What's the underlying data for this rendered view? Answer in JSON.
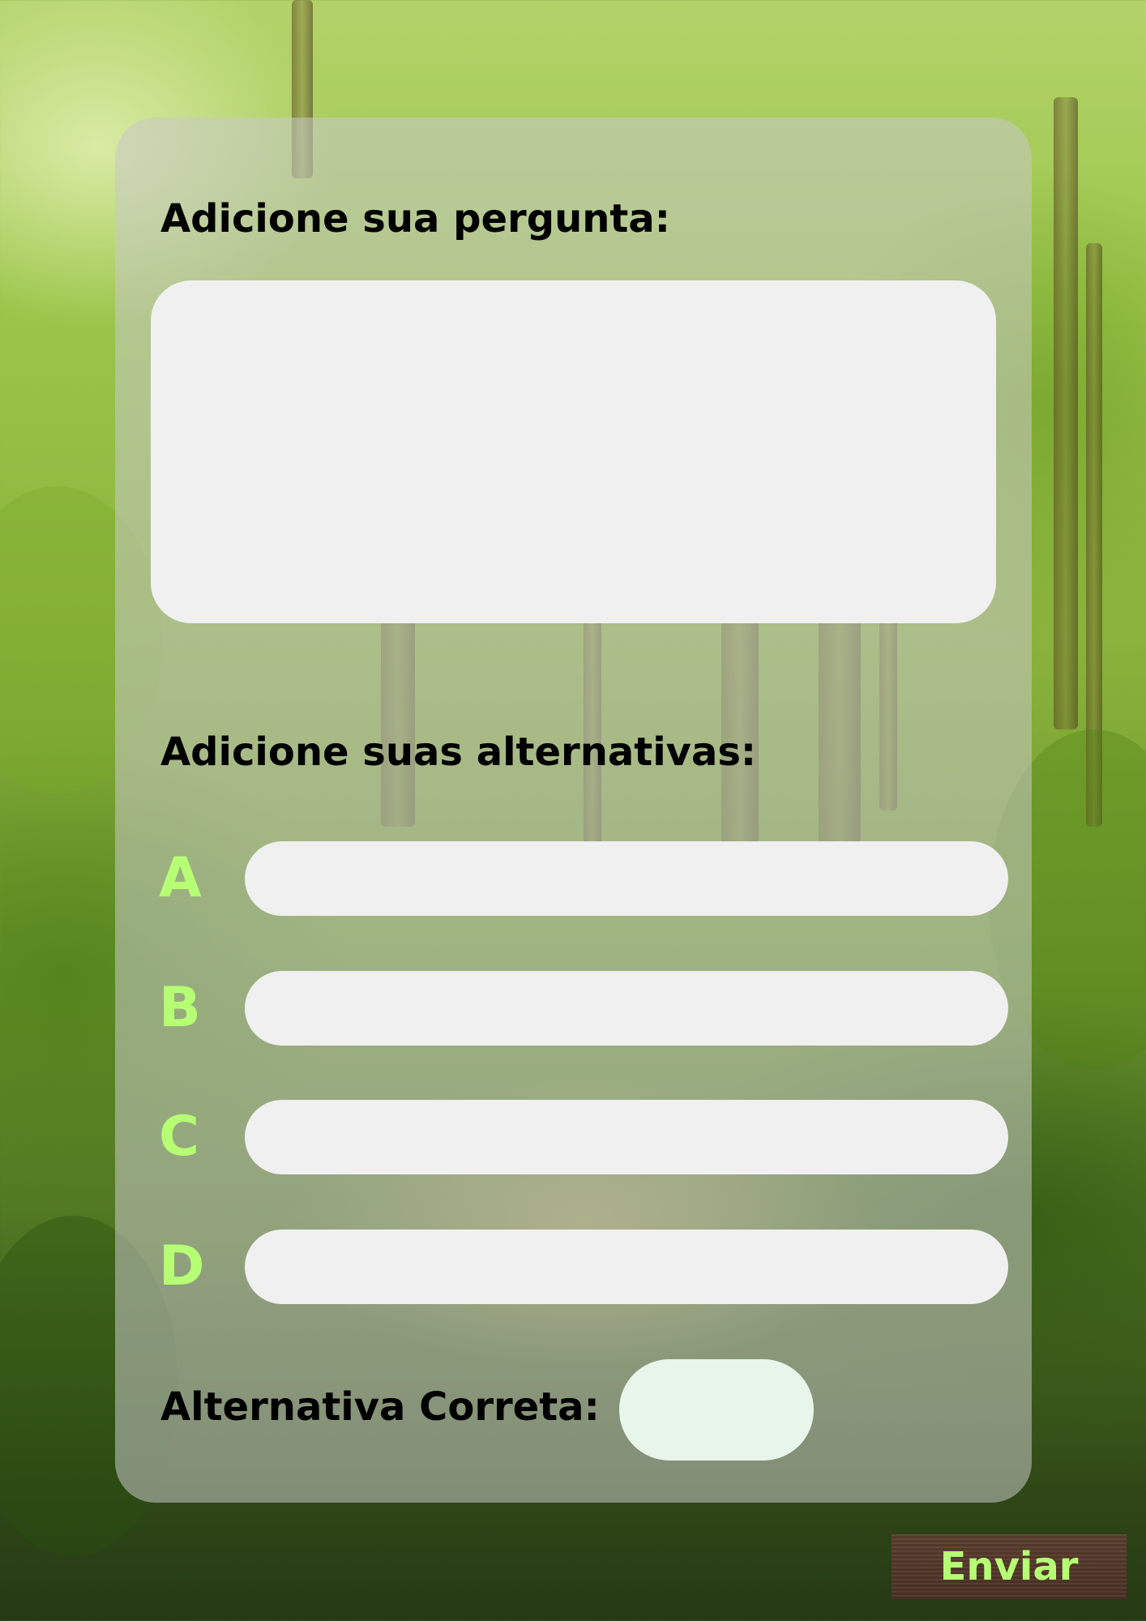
{
  "form": {
    "question_heading": "Adicione sua pergunta:",
    "question_value": "",
    "alternatives_heading": "Adicione suas alternativas:",
    "alternatives": [
      {
        "letter": "A",
        "value": ""
      },
      {
        "letter": "B",
        "value": ""
      },
      {
        "letter": "C",
        "value": ""
      },
      {
        "letter": "D",
        "value": ""
      }
    ],
    "correct_label": "Alternativa Correta:",
    "correct_value": "",
    "submit_label": "Enviar"
  },
  "colors": {
    "letter_accent": "#b6ff74",
    "button_bg": "#4e3426",
    "input_bg": "#f0f0f0",
    "correct_input_bg": "#e8f5ea"
  },
  "background": {
    "theme": "forest-photo"
  }
}
